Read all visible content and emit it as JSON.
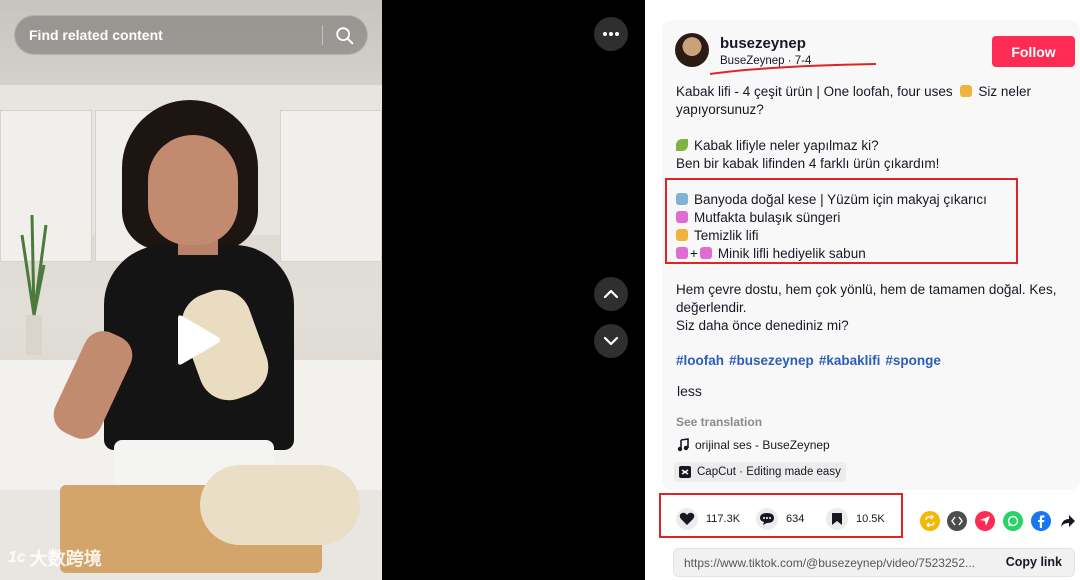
{
  "search": {
    "placeholder": "Find related content"
  },
  "watermark": {
    "logo": "1c",
    "text": "大数跨境"
  },
  "author": {
    "username": "busezeynep",
    "display_and_date": "BuseZeynep · 7-4"
  },
  "follow_label": "Follow",
  "description": {
    "title_line1": "Kabak lifi - 4 çeşit ürün | One loofah, four uses",
    "title_line1_tail": "Siz neler",
    "title_line2": "yapıyorsunuz?",
    "q_line1": "Kabak lifiyle neler yapılmaz ki?",
    "q_line2": "Ben bir kabak lifinden 4 farklı ürün çıkardım!",
    "list": [
      {
        "icon": "bathtub-icon",
        "color": "#7fb3d5",
        "text": "Banyoda doğal kese | Yüzüm için makyaj çıkarıcı"
      },
      {
        "icon": "soap-icon",
        "color": "#e06bd3",
        "text": "Mutfakta bulaşık süngeri"
      },
      {
        "icon": "sponge-icon",
        "color": "#f0b43c",
        "text": "Temizlik lifi"
      },
      {
        "icon": "soap-plus-soap-icon",
        "color": "#e06bd3",
        "text": "Minik lifli hediyelik sabun"
      }
    ],
    "outro1": "Hem çevre dostu, hem çok yönlü, hem de tamamen doğal. Kes,",
    "outro2": "değerlendir.",
    "outro3": "Siz daha önce denediniz mi?"
  },
  "hashtags": [
    "#loofah",
    "#busezeynep",
    "#kabaklifi",
    "#sponge"
  ],
  "less_label": "less",
  "see_translation": "See translation",
  "music": "orijinal ses - BuseZeynep",
  "capcut": "CapCut · Editing made easy",
  "stats": {
    "likes": "117.3K",
    "comments": "634",
    "saves": "10.5K"
  },
  "share": {
    "icons": [
      {
        "name": "repost-icon",
        "color": "#f5b800"
      },
      {
        "name": "embed-icon",
        "color": "#4d4d4d"
      },
      {
        "name": "send-icon",
        "color": "#fe2c55"
      },
      {
        "name": "whatsapp-icon",
        "color": "#25d366"
      },
      {
        "name": "facebook-icon",
        "color": "#1877f2"
      },
      {
        "name": "share-arrow-icon",
        "color": "#161823"
      }
    ]
  },
  "link": {
    "url": "https://www.tiktok.com/@busezeynep/video/7523252...",
    "copy_label": "Copy link"
  },
  "annotation_color": "#e02424"
}
